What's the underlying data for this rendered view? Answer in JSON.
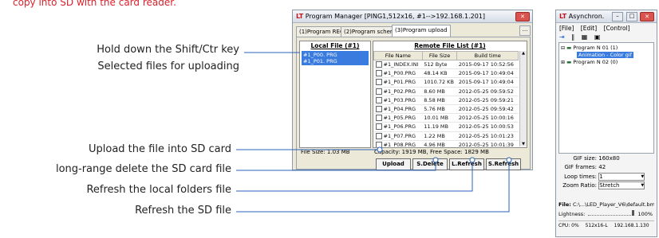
{
  "caption": "copy into SD with the card reader.",
  "callouts": {
    "shift": "Hold down the Shift/Ctr key",
    "selected": "Selected files for uploading",
    "upload": "Upload the file into SD card",
    "delete": "long-range delete the SD card file",
    "refresh_local": "Refresh the local folders file",
    "refresh_sd": "Refresh the SD file"
  },
  "program_manager": {
    "title_prefix": "LT",
    "title": "Program Manager  [PING1,512x16,  #1-->192.168.1.201]",
    "tabs": [
      "(1)Program REC",
      "(2)Program scheme",
      "(3)Program upload"
    ],
    "ellipsis": "...",
    "local": {
      "header": "Local File (#1)",
      "files": [
        "#1_P00. PRG",
        "#1_P01. PRG"
      ],
      "file_size": "File Size: 1.03 MB"
    },
    "remote": {
      "header": "Remote File List (#1)",
      "columns": [
        "File Name",
        "File Size",
        "Build time"
      ],
      "rows": [
        [
          "#1_INDEX.INI",
          "512 Byte",
          "2015-09-17 10:52:56"
        ],
        [
          "#1_P00.PRG",
          "48.14 KB",
          "2015-09-17 10:49:04"
        ],
        [
          "#1_P01.PRG",
          "1010.72 KB",
          "2015-09-17 10:49:04"
        ],
        [
          "#1_P02.PRG",
          "8.60 MB",
          "2012-05-25 09:59:52"
        ],
        [
          "#1_P03.PRG",
          "8.58 MB",
          "2012-05-25 09:59:21"
        ],
        [
          "#1_P04.PRG",
          "5.76 MB",
          "2012-05-25 09:59:42"
        ],
        [
          "#1_P05.PRG",
          "10.01 MB",
          "2012-05-25 10:00:16"
        ],
        [
          "#1_P06.PRG",
          "11.19 MB",
          "2012-05-25 10:00:53"
        ],
        [
          "#1_P07.PRG",
          "1.22 MB",
          "2012-05-25 10:01:23"
        ],
        [
          "#1_P08.PRG",
          "4.96 MB",
          "2012-05-25 10:01:39"
        ],
        [
          "#1_P09.PRG",
          "4.56 MB",
          "2012-05-25 10:01:58"
        ]
      ],
      "capacity": "Capacity: 1919 MB,  Free Space: 1829 MB"
    },
    "buttons": {
      "upload": "Upload",
      "delete": "S.Delete",
      "refresh_local": "L.Refresh",
      "refresh_sd": "S.Refresh"
    }
  },
  "async_window": {
    "title_prefix": "LT",
    "title": "Asynchron.",
    "menu": [
      "[File]",
      "[Edit]",
      "[Control]"
    ],
    "tree": {
      "program1": "Program N 01 (1)",
      "animation": "Animation - Color gif",
      "program2": "Program N 02 (0)"
    },
    "props": {
      "gif_size_label": "GIF size:",
      "gif_size_value": "160x80",
      "gif_frames_label": "GIF frames:",
      "gif_frames_value": "42",
      "loop_label": "Loop times:",
      "loop_value": "1",
      "zoom_label": "Zoom Ratio:",
      "zoom_value": "Stretch"
    },
    "file_label": "File:",
    "file_path": "C:\\...\\LED_Player_V6\\default.bmn",
    "lightness_label": "Lightness:",
    "lightness_value": "100%",
    "status": [
      "CPU: 0%",
      "512x16-L",
      "192.168.1.130"
    ]
  },
  "colors": {
    "caption": "#d8222b",
    "selection": "#3a7be0",
    "callout_line": "#2a62b8"
  }
}
